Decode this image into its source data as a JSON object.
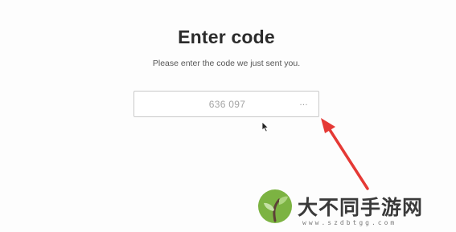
{
  "screen": {
    "title": "Enter code",
    "subtitle": "Please enter the code we just sent you."
  },
  "code_input": {
    "value": "636 097",
    "trailing_icon": "ellipsis-icon"
  },
  "annotation": {
    "arrow_color": "#e53935"
  },
  "watermark": {
    "text": "大不同手游网",
    "url": "www.szdbtgg.com",
    "logo_color": "#7cb342"
  },
  "colors": {
    "title": "#2b2b2b",
    "subtitle": "#555555",
    "input_border": "#c9c9c9",
    "input_text": "#a4a4a4"
  }
}
